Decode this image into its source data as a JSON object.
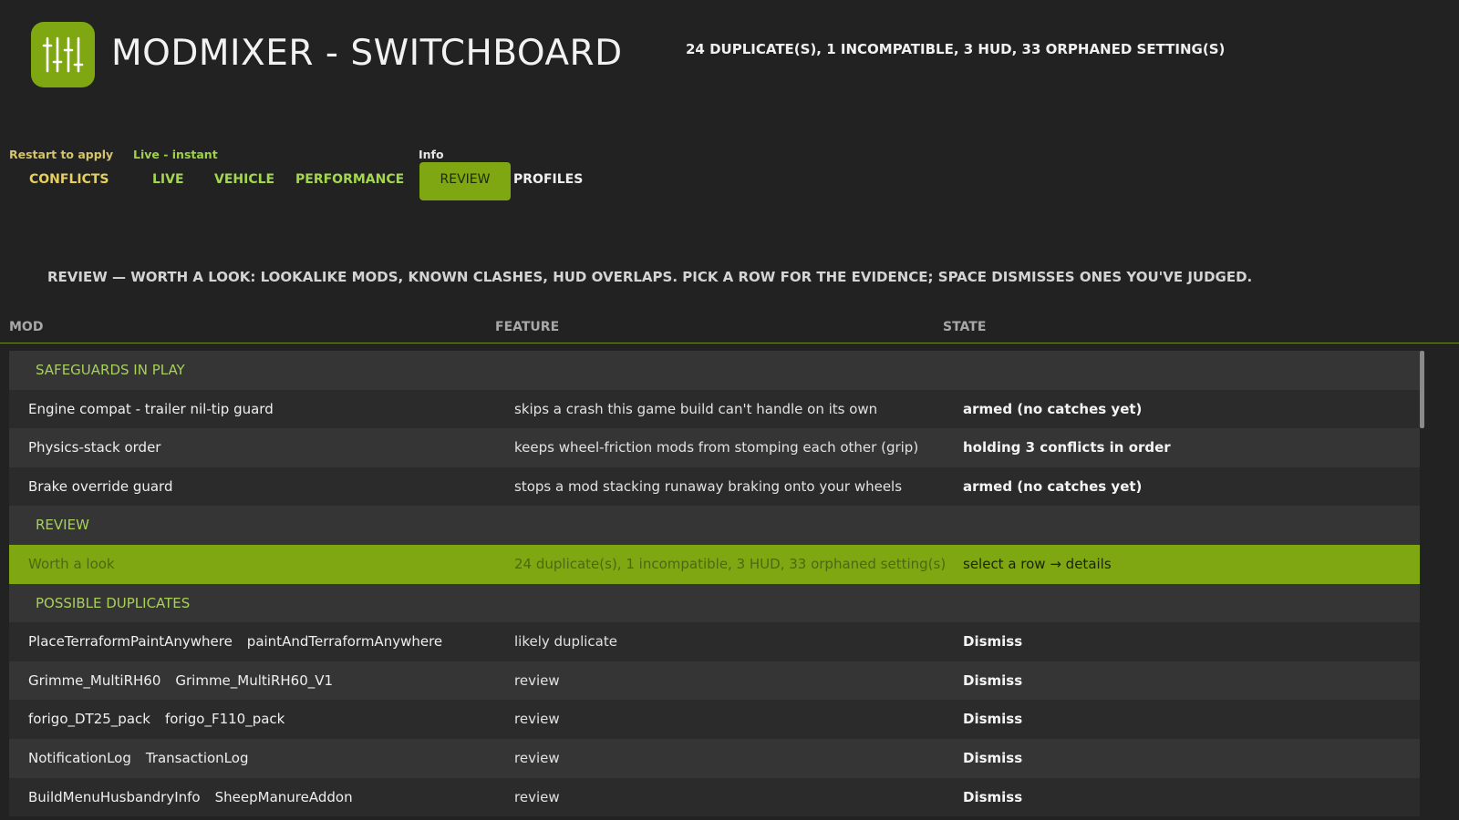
{
  "header": {
    "title": "MODMIXER - SWITCHBOARD",
    "summary": "24 DUPLICATE(S), 1 INCOMPATIBLE, 3 HUD, 33 ORPHANED SETTING(S)",
    "logo_icon": "mixer-sliders-icon",
    "accent_color": "#7ea712"
  },
  "tab_groups": {
    "restart": "Restart to apply",
    "live": "Live - instant",
    "info": "Info"
  },
  "tabs": {
    "conflicts": "CONFLICTS",
    "live": "LIVE",
    "vehicle": "VEHICLE",
    "performance": "PERFORMANCE",
    "review": "REVIEW",
    "profiles": "PROFILES",
    "active": "REVIEW"
  },
  "hint": "REVIEW — WORTH A LOOK: LOOKALIKE MODS, KNOWN CLASHES, HUD OVERLAPS. PICK A ROW FOR THE EVIDENCE; SPACE DISMISSES ONES YOU'VE JUDGED.",
  "columns": {
    "mod": "MOD",
    "feature": "FEATURE",
    "state": "STATE"
  },
  "sections": {
    "safeguards": {
      "label": "SAFEGUARDS IN PLAY",
      "rows": [
        {
          "mod": "Engine compat - trailer nil-tip guard",
          "feature": "skips a crash this game build can't handle on its own",
          "state": "armed (no catches yet)"
        },
        {
          "mod": "Physics-stack order",
          "feature": "keeps wheel-friction mods from stomping each other (grip)",
          "state": "holding 3 conflicts in order"
        },
        {
          "mod": "Brake override guard",
          "feature": "stops a mod stacking runaway braking onto your wheels",
          "state": "armed (no catches yet)"
        }
      ]
    },
    "review": {
      "label": "REVIEW",
      "rows": [
        {
          "mod": "Worth a look",
          "feature": "24 duplicate(s), 1 incompatible, 3 HUD, 33 orphaned setting(s)",
          "state": "select a row → details"
        }
      ]
    },
    "duplicates": {
      "label": "POSSIBLE DUPLICATES",
      "rows": [
        {
          "mod_a": "PlaceTerraformPaintAnywhere",
          "mod_b": "paintAndTerraformAnywhere",
          "feature": "likely duplicate",
          "state": "Dismiss"
        },
        {
          "mod_a": "Grimme_MultiRH60",
          "mod_b": "Grimme_MultiRH60_V1",
          "feature": "review",
          "state": "Dismiss"
        },
        {
          "mod_a": "forigo_DT25_pack",
          "mod_b": "forigo_F110_pack",
          "feature": "review",
          "state": "Dismiss"
        },
        {
          "mod_a": "NotificationLog",
          "mod_b": "TransactionLog",
          "feature": "review",
          "state": "Dismiss"
        },
        {
          "mod_a": "BuildMenuHusbandryInfo",
          "mod_b": "SheepManureAddon",
          "feature": "review",
          "state": "Dismiss"
        }
      ]
    }
  }
}
